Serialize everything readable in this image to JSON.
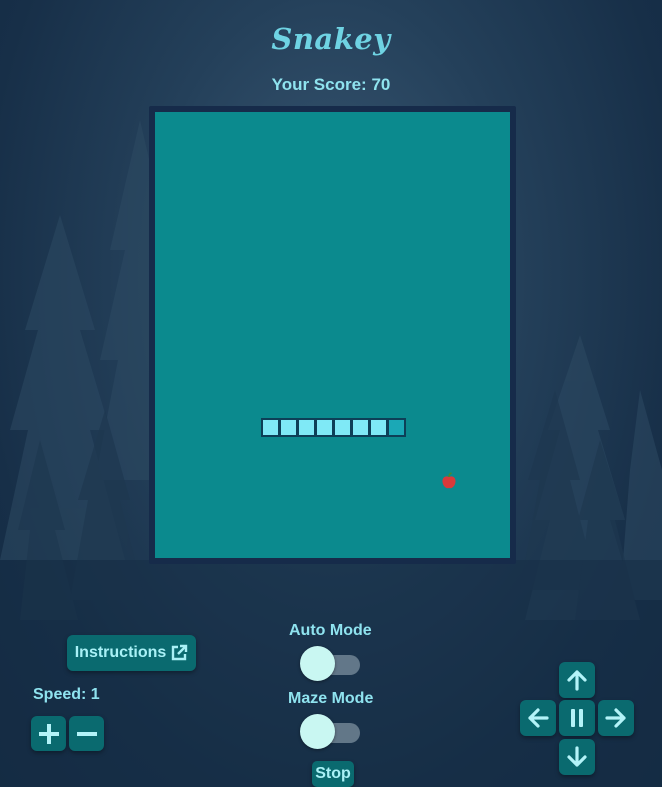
{
  "app": {
    "title": "Snakey"
  },
  "score": {
    "text": "Your Score: 70",
    "value": 70
  },
  "game": {
    "snake_segments": 8,
    "food": "apple-icon"
  },
  "controls": {
    "instructions_label": "Instructions",
    "speed_text": "Speed: 1",
    "speed_value": 1,
    "auto_mode_label": "Auto Mode",
    "auto_mode_on": false,
    "maze_mode_label": "Maze Mode",
    "maze_mode_on": false,
    "stop_label": "Stop"
  },
  "colors": {
    "board": "#0b8a8e",
    "snake_body": "#7fe9f6",
    "snake_head": "#1ba8b6",
    "button": "#0a6a6f",
    "text": "#8fe3ef"
  }
}
